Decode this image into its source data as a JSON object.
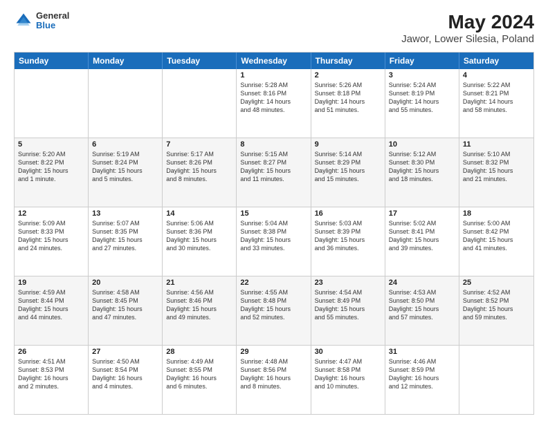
{
  "header": {
    "logo_line1": "General",
    "logo_line2": "Blue",
    "title": "May 2024",
    "subtitle": "Jawor, Lower Silesia, Poland"
  },
  "calendar": {
    "headers": [
      "Sunday",
      "Monday",
      "Tuesday",
      "Wednesday",
      "Thursday",
      "Friday",
      "Saturday"
    ],
    "rows": [
      [
        {
          "day": "",
          "lines": []
        },
        {
          "day": "",
          "lines": []
        },
        {
          "day": "",
          "lines": []
        },
        {
          "day": "1",
          "lines": [
            "Sunrise: 5:28 AM",
            "Sunset: 8:16 PM",
            "Daylight: 14 hours",
            "and 48 minutes."
          ]
        },
        {
          "day": "2",
          "lines": [
            "Sunrise: 5:26 AM",
            "Sunset: 8:18 PM",
            "Daylight: 14 hours",
            "and 51 minutes."
          ]
        },
        {
          "day": "3",
          "lines": [
            "Sunrise: 5:24 AM",
            "Sunset: 8:19 PM",
            "Daylight: 14 hours",
            "and 55 minutes."
          ]
        },
        {
          "day": "4",
          "lines": [
            "Sunrise: 5:22 AM",
            "Sunset: 8:21 PM",
            "Daylight: 14 hours",
            "and 58 minutes."
          ]
        }
      ],
      [
        {
          "day": "5",
          "lines": [
            "Sunrise: 5:20 AM",
            "Sunset: 8:22 PM",
            "Daylight: 15 hours",
            "and 1 minute."
          ]
        },
        {
          "day": "6",
          "lines": [
            "Sunrise: 5:19 AM",
            "Sunset: 8:24 PM",
            "Daylight: 15 hours",
            "and 5 minutes."
          ]
        },
        {
          "day": "7",
          "lines": [
            "Sunrise: 5:17 AM",
            "Sunset: 8:26 PM",
            "Daylight: 15 hours",
            "and 8 minutes."
          ]
        },
        {
          "day": "8",
          "lines": [
            "Sunrise: 5:15 AM",
            "Sunset: 8:27 PM",
            "Daylight: 15 hours",
            "and 11 minutes."
          ]
        },
        {
          "day": "9",
          "lines": [
            "Sunrise: 5:14 AM",
            "Sunset: 8:29 PM",
            "Daylight: 15 hours",
            "and 15 minutes."
          ]
        },
        {
          "day": "10",
          "lines": [
            "Sunrise: 5:12 AM",
            "Sunset: 8:30 PM",
            "Daylight: 15 hours",
            "and 18 minutes."
          ]
        },
        {
          "day": "11",
          "lines": [
            "Sunrise: 5:10 AM",
            "Sunset: 8:32 PM",
            "Daylight: 15 hours",
            "and 21 minutes."
          ]
        }
      ],
      [
        {
          "day": "12",
          "lines": [
            "Sunrise: 5:09 AM",
            "Sunset: 8:33 PM",
            "Daylight: 15 hours",
            "and 24 minutes."
          ]
        },
        {
          "day": "13",
          "lines": [
            "Sunrise: 5:07 AM",
            "Sunset: 8:35 PM",
            "Daylight: 15 hours",
            "and 27 minutes."
          ]
        },
        {
          "day": "14",
          "lines": [
            "Sunrise: 5:06 AM",
            "Sunset: 8:36 PM",
            "Daylight: 15 hours",
            "and 30 minutes."
          ]
        },
        {
          "day": "15",
          "lines": [
            "Sunrise: 5:04 AM",
            "Sunset: 8:38 PM",
            "Daylight: 15 hours",
            "and 33 minutes."
          ]
        },
        {
          "day": "16",
          "lines": [
            "Sunrise: 5:03 AM",
            "Sunset: 8:39 PM",
            "Daylight: 15 hours",
            "and 36 minutes."
          ]
        },
        {
          "day": "17",
          "lines": [
            "Sunrise: 5:02 AM",
            "Sunset: 8:41 PM",
            "Daylight: 15 hours",
            "and 39 minutes."
          ]
        },
        {
          "day": "18",
          "lines": [
            "Sunrise: 5:00 AM",
            "Sunset: 8:42 PM",
            "Daylight: 15 hours",
            "and 41 minutes."
          ]
        }
      ],
      [
        {
          "day": "19",
          "lines": [
            "Sunrise: 4:59 AM",
            "Sunset: 8:44 PM",
            "Daylight: 15 hours",
            "and 44 minutes."
          ]
        },
        {
          "day": "20",
          "lines": [
            "Sunrise: 4:58 AM",
            "Sunset: 8:45 PM",
            "Daylight: 15 hours",
            "and 47 minutes."
          ]
        },
        {
          "day": "21",
          "lines": [
            "Sunrise: 4:56 AM",
            "Sunset: 8:46 PM",
            "Daylight: 15 hours",
            "and 49 minutes."
          ]
        },
        {
          "day": "22",
          "lines": [
            "Sunrise: 4:55 AM",
            "Sunset: 8:48 PM",
            "Daylight: 15 hours",
            "and 52 minutes."
          ]
        },
        {
          "day": "23",
          "lines": [
            "Sunrise: 4:54 AM",
            "Sunset: 8:49 PM",
            "Daylight: 15 hours",
            "and 55 minutes."
          ]
        },
        {
          "day": "24",
          "lines": [
            "Sunrise: 4:53 AM",
            "Sunset: 8:50 PM",
            "Daylight: 15 hours",
            "and 57 minutes."
          ]
        },
        {
          "day": "25",
          "lines": [
            "Sunrise: 4:52 AM",
            "Sunset: 8:52 PM",
            "Daylight: 15 hours",
            "and 59 minutes."
          ]
        }
      ],
      [
        {
          "day": "26",
          "lines": [
            "Sunrise: 4:51 AM",
            "Sunset: 8:53 PM",
            "Daylight: 16 hours",
            "and 2 minutes."
          ]
        },
        {
          "day": "27",
          "lines": [
            "Sunrise: 4:50 AM",
            "Sunset: 8:54 PM",
            "Daylight: 16 hours",
            "and 4 minutes."
          ]
        },
        {
          "day": "28",
          "lines": [
            "Sunrise: 4:49 AM",
            "Sunset: 8:55 PM",
            "Daylight: 16 hours",
            "and 6 minutes."
          ]
        },
        {
          "day": "29",
          "lines": [
            "Sunrise: 4:48 AM",
            "Sunset: 8:56 PM",
            "Daylight: 16 hours",
            "and 8 minutes."
          ]
        },
        {
          "day": "30",
          "lines": [
            "Sunrise: 4:47 AM",
            "Sunset: 8:58 PM",
            "Daylight: 16 hours",
            "and 10 minutes."
          ]
        },
        {
          "day": "31",
          "lines": [
            "Sunrise: 4:46 AM",
            "Sunset: 8:59 PM",
            "Daylight: 16 hours",
            "and 12 minutes."
          ]
        },
        {
          "day": "",
          "lines": []
        }
      ]
    ]
  }
}
